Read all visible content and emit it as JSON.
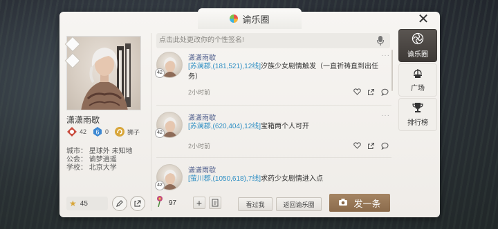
{
  "window": {
    "title": "谕乐圈"
  },
  "profile": {
    "name": "潇潇雨歇",
    "stats": [
      {
        "icon": "hexagram-icon",
        "value": "42"
      },
      {
        "icon": "number-six-icon",
        "value": "0"
      },
      {
        "icon": "lion-icon",
        "value": "狮子"
      }
    ],
    "city": "城市：  星球外  未知地",
    "guild": "公会：  谕梦逍遥",
    "school": "学校：  北京大学",
    "likes": "45"
  },
  "signature": {
    "placeholder": "点击此处更改你的个性签名!"
  },
  "posts": [
    {
      "author": "潇潇雨歇",
      "level": "42",
      "location": "[苏澜郡,(181,521),12线]",
      "text": "汐族少女剧情触发（一直祈祷直到出任务）",
      "time": "2小时前"
    },
    {
      "author": "潇潇雨歇",
      "level": "42",
      "location": "[苏澜郡,(620,404),12线]",
      "text": "宝箱两个人可开",
      "time": "2小时前"
    },
    {
      "author": "潇潇雨歇",
      "level": "42",
      "location": "[萤川郡,(1050,618),7线]",
      "text": "求药少女剧情进入点",
      "time": ""
    }
  ],
  "bottom": {
    "flower_count": "97",
    "seen_me": "看过我",
    "back": "返回谕乐圈",
    "post": "发一条"
  },
  "right_tabs": [
    {
      "icon": "swirl-icon",
      "label": "谕乐圈"
    },
    {
      "icon": "fountain-icon",
      "label": "广场"
    },
    {
      "icon": "trophy-icon",
      "label": "排行榜"
    }
  ],
  "colors": {
    "accent_brown": "#8b6b4b",
    "link_blue": "#2f8fc4",
    "active_tab": "#3d3936"
  }
}
